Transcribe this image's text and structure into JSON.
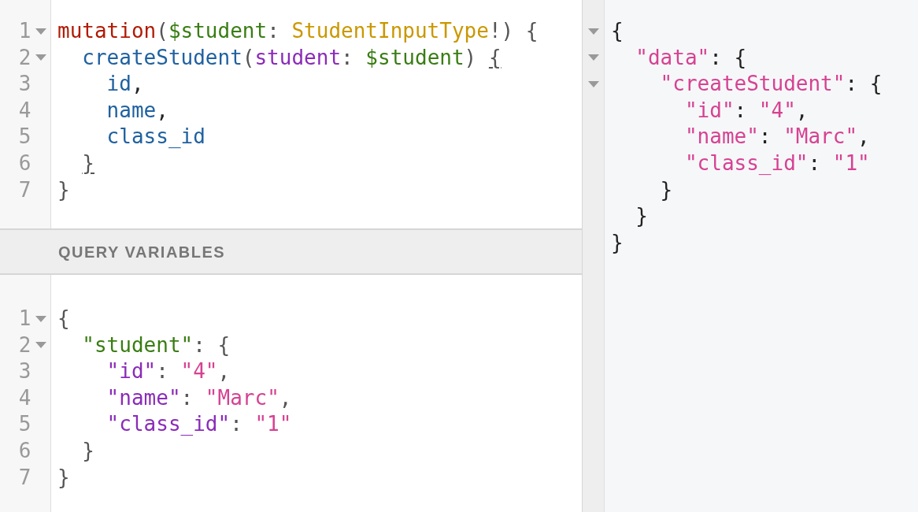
{
  "query_editor": {
    "lines": [
      {
        "number": "1",
        "foldable": true,
        "tokens": [
          {
            "kind": "keyword",
            "text": "mutation"
          },
          {
            "kind": "punct",
            "text": "("
          },
          {
            "kind": "variable",
            "text": "$student"
          },
          {
            "kind": "punct",
            "text": ": "
          },
          {
            "kind": "type",
            "text": "StudentInputType"
          },
          {
            "kind": "punct",
            "text": "!) {"
          }
        ]
      },
      {
        "number": "2",
        "foldable": true,
        "tokens": [
          {
            "kind": "field",
            "text": "  createStudent"
          },
          {
            "kind": "punct",
            "text": "("
          },
          {
            "kind": "attribute",
            "text": "student"
          },
          {
            "kind": "punct",
            "text": ": "
          },
          {
            "kind": "variable",
            "text": "$student"
          },
          {
            "kind": "punct",
            "text": ") "
          },
          {
            "kind": "punct",
            "text": "{",
            "matched": true
          }
        ]
      },
      {
        "number": "3",
        "foldable": false,
        "tokens": [
          {
            "kind": "field",
            "text": "    id"
          },
          {
            "kind": "plain",
            "text": ","
          }
        ]
      },
      {
        "number": "4",
        "foldable": false,
        "tokens": [
          {
            "kind": "field",
            "text": "    name"
          },
          {
            "kind": "plain",
            "text": ","
          }
        ]
      },
      {
        "number": "5",
        "foldable": false,
        "tokens": [
          {
            "kind": "field",
            "text": "    class_id"
          }
        ]
      },
      {
        "number": "6",
        "foldable": false,
        "tokens": [
          {
            "kind": "punct",
            "text": "  }",
            "matched": true
          }
        ]
      },
      {
        "number": "7",
        "foldable": false,
        "tokens": [
          {
            "kind": "punct",
            "text": "}"
          }
        ]
      }
    ]
  },
  "variables_header": "QUERY VARIABLES",
  "variables_editor": {
    "lines": [
      {
        "number": "1",
        "foldable": true,
        "tokens": [
          {
            "kind": "punct",
            "text": "{"
          }
        ]
      },
      {
        "number": "2",
        "foldable": true,
        "tokens": [
          {
            "kind": "variable",
            "text": "  \"student\""
          },
          {
            "kind": "punct",
            "text": ": {"
          }
        ]
      },
      {
        "number": "3",
        "foldable": false,
        "tokens": [
          {
            "kind": "attribute",
            "text": "    \"id\""
          },
          {
            "kind": "punct",
            "text": ": "
          },
          {
            "kind": "string",
            "text": "\"4\""
          },
          {
            "kind": "punct",
            "text": ","
          }
        ]
      },
      {
        "number": "4",
        "foldable": false,
        "tokens": [
          {
            "kind": "attribute",
            "text": "    \"name\""
          },
          {
            "kind": "punct",
            "text": ": "
          },
          {
            "kind": "string",
            "text": "\"Marc\""
          },
          {
            "kind": "punct",
            "text": ","
          }
        ]
      },
      {
        "number": "5",
        "foldable": false,
        "tokens": [
          {
            "kind": "attribute",
            "text": "    \"class_id\""
          },
          {
            "kind": "punct",
            "text": ": "
          },
          {
            "kind": "string",
            "text": "\"1\""
          }
        ]
      },
      {
        "number": "6",
        "foldable": false,
        "tokens": [
          {
            "kind": "punct",
            "text": "  }"
          }
        ]
      },
      {
        "number": "7",
        "foldable": false,
        "tokens": [
          {
            "kind": "punct",
            "text": "}"
          }
        ]
      }
    ]
  },
  "result_viewer": {
    "lines": [
      {
        "foldable": true,
        "tokens": [
          {
            "kind": "plain",
            "text": "{"
          }
        ]
      },
      {
        "foldable": true,
        "tokens": [
          {
            "kind": "string",
            "text": "  \"data\""
          },
          {
            "kind": "plain",
            "text": ": {"
          }
        ]
      },
      {
        "foldable": true,
        "tokens": [
          {
            "kind": "string",
            "text": "    \"createStudent\""
          },
          {
            "kind": "plain",
            "text": ": {"
          }
        ]
      },
      {
        "foldable": false,
        "tokens": [
          {
            "kind": "string",
            "text": "      \"id\""
          },
          {
            "kind": "plain",
            "text": ": "
          },
          {
            "kind": "string",
            "text": "\"4\""
          },
          {
            "kind": "plain",
            "text": ","
          }
        ]
      },
      {
        "foldable": false,
        "tokens": [
          {
            "kind": "string",
            "text": "      \"name\""
          },
          {
            "kind": "plain",
            "text": ": "
          },
          {
            "kind": "string",
            "text": "\"Marc\""
          },
          {
            "kind": "plain",
            "text": ","
          }
        ]
      },
      {
        "foldable": false,
        "tokens": [
          {
            "kind": "string",
            "text": "      \"class_id\""
          },
          {
            "kind": "plain",
            "text": ": "
          },
          {
            "kind": "string",
            "text": "\"1\""
          }
        ]
      },
      {
        "foldable": false,
        "tokens": [
          {
            "kind": "plain",
            "text": "    }"
          }
        ]
      },
      {
        "foldable": false,
        "tokens": [
          {
            "kind": "plain",
            "text": "  }"
          }
        ]
      },
      {
        "foldable": false,
        "tokens": [
          {
            "kind": "plain",
            "text": "}"
          }
        ]
      }
    ]
  }
}
